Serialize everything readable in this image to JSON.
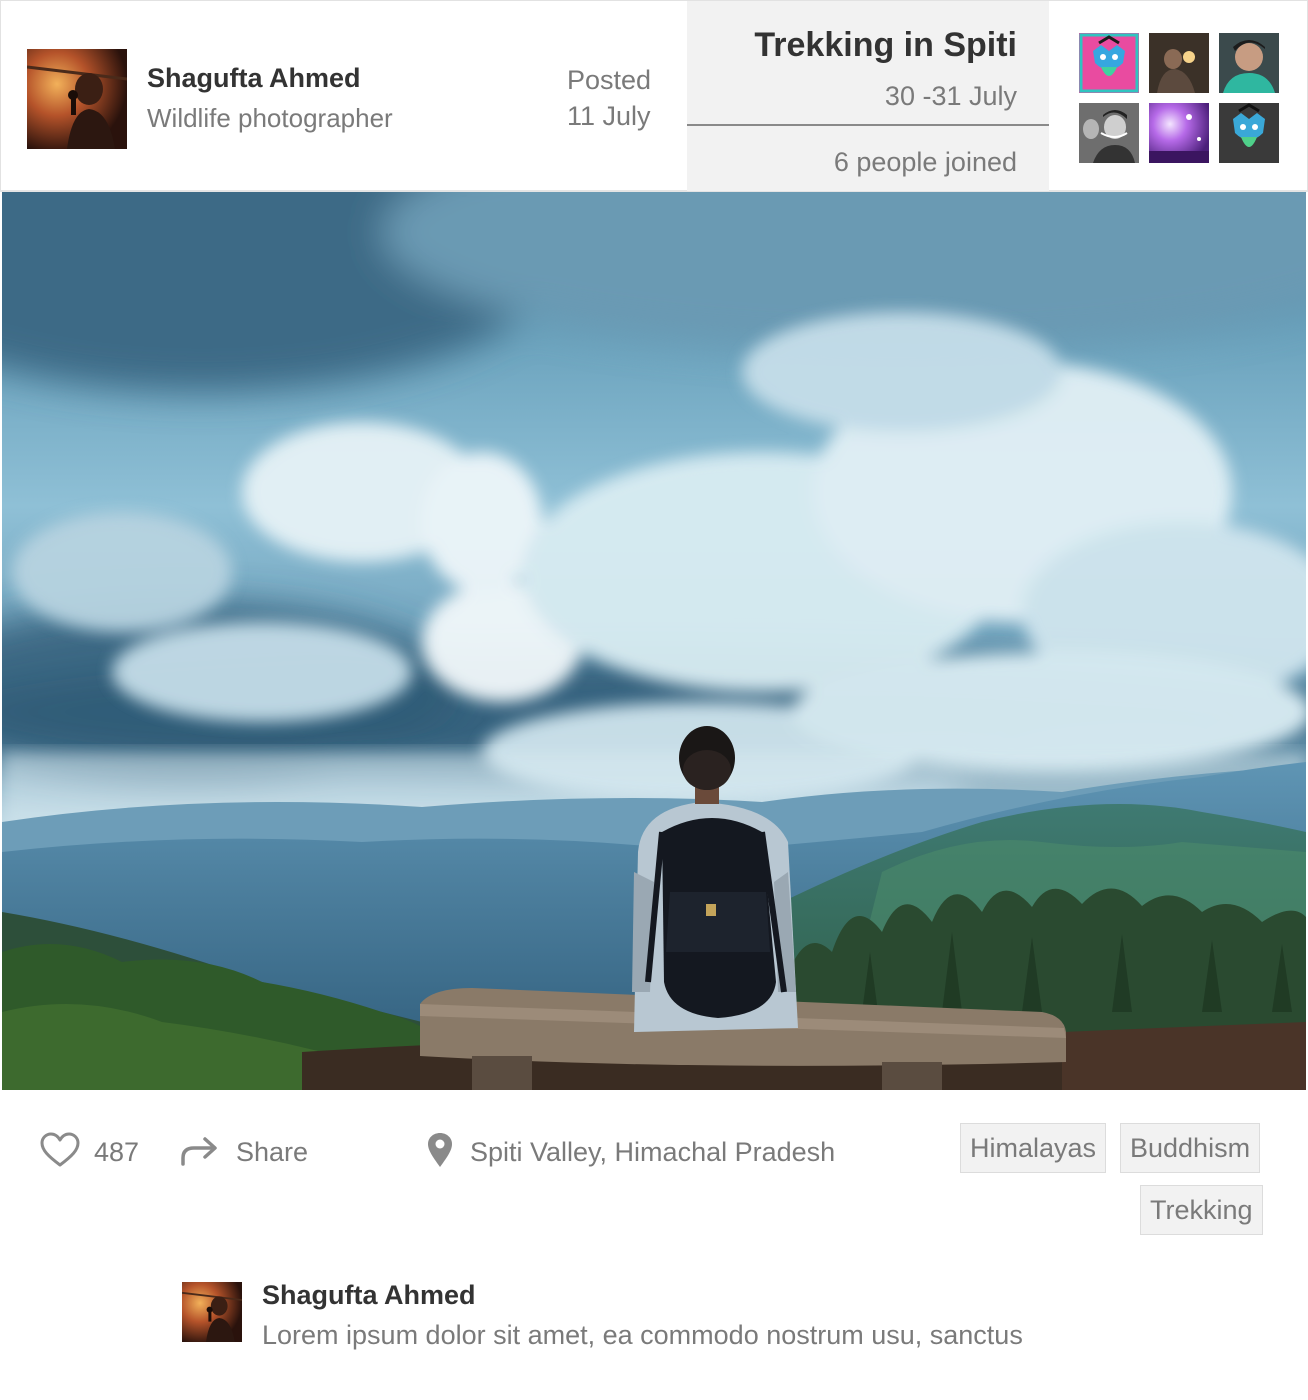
{
  "author": {
    "name": "Shagufta Ahmed",
    "role": "Wildlife photographer"
  },
  "post": {
    "posted_label": "Posted",
    "posted_date": "11 July"
  },
  "event": {
    "title": "Trekking in Spiti",
    "dates": "30 -31 July",
    "joined": "6 people joined"
  },
  "participants": [
    {
      "name": "participant-avatar-1",
      "style": "blue-mascot-pink-bg"
    },
    {
      "name": "participant-avatar-2",
      "style": "photo-dark-warm"
    },
    {
      "name": "participant-avatar-3",
      "style": "photo-teal"
    },
    {
      "name": "participant-avatar-4",
      "style": "photo-grayscale"
    },
    {
      "name": "participant-avatar-5",
      "style": "photo-purple-lights"
    },
    {
      "name": "participant-avatar-6",
      "style": "blue-mascot-dark-bg"
    }
  ],
  "hero": {
    "icon": "landscape-photo"
  },
  "actions": {
    "like_icon": "heart-outline-icon",
    "like_count": "487",
    "share_icon": "share-arrow-icon",
    "share_label": "Share",
    "location_icon": "map-pin-icon",
    "location": "Spiti Valley, Himachal Pradesh"
  },
  "tags": [
    "Himalayas",
    "Buddhism",
    "Trekking"
  ],
  "comment": {
    "author": "Shagufta Ahmed",
    "text": "Lorem ipsum dolor sit amet, ea commodo nostrum usu, sanctus"
  },
  "colors": {
    "text_dark": "#333333",
    "text_muted": "#7a7a7a",
    "panel_bg": "#f2f2f2",
    "tag_border": "#dcdcdc"
  }
}
